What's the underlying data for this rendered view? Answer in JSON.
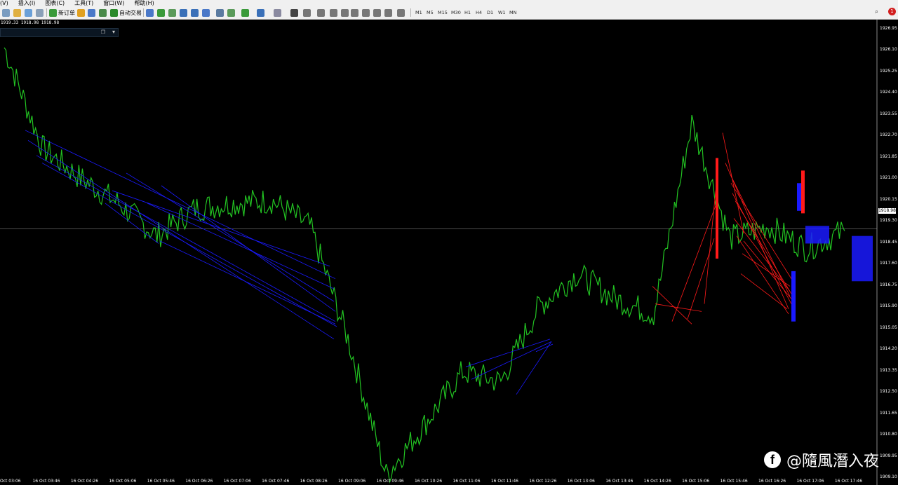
{
  "menu": [
    "(V)",
    "插入(I)",
    "图表(C)",
    "工具(T)",
    "窗口(W)",
    "帮助(H)"
  ],
  "toolbar": {
    "new_order_label": "新订单",
    "auto_trading_label": "自动交易",
    "timeframes": [
      "M1",
      "M5",
      "M15",
      "M30",
      "H1",
      "H4",
      "D1",
      "W1",
      "MN"
    ],
    "notification_count": "1"
  },
  "chart_info": {
    "ohlc_line": "1919.33 1918.98 1918.98",
    "current_price": "1918.98"
  },
  "y_axis_labels": [
    "1926.95",
    "1926.10",
    "1925.25",
    "1924.40",
    "1923.55",
    "1922.70",
    "1921.85",
    "1921.00",
    "1920.15",
    "1919.30",
    "1918.45",
    "1917.60",
    "1916.75",
    "1915.90",
    "1915.05",
    "1914.20",
    "1913.35",
    "1912.50",
    "1911.65",
    "1910.80",
    "1909.95",
    "1909.10"
  ],
  "x_axis_labels": [
    "Oct 03:06",
    "16 Oct 03:46",
    "16 Oct 04:26",
    "16 Oct 05:06",
    "16 Oct 05:46",
    "16 Oct 06:26",
    "16 Oct 07:06",
    "16 Oct 07:46",
    "16 Oct 08:26",
    "16 Oct 09:06",
    "16 Oct 09:46",
    "16 Oct 10:26",
    "16 Oct 11:06",
    "16 Oct 11:46",
    "16 Oct 12:26",
    "16 Oct 13:06",
    "16 Oct 13:46",
    "16 Oct 14:26",
    "16 Oct 15:06",
    "16 Oct 15:46",
    "16 Oct 16:26",
    "16 Oct 17:06",
    "16 Oct 17:46"
  ],
  "watermark": {
    "icon": "facebook-icon",
    "text": "@隨風潛入夜"
  },
  "colors": {
    "price_line": "#22c322",
    "buy_lines": "#1a1aff",
    "sell_lines": "#ff1a1a",
    "background": "#000000"
  },
  "chart_data": {
    "type": "line",
    "ylim": [
      1908.8,
      1927.3
    ],
    "x": [
      "03:06",
      "03:46",
      "04:26",
      "05:06",
      "05:46",
      "06:26",
      "07:06",
      "07:46",
      "08:26",
      "09:06",
      "09:46",
      "10:26",
      "11:06",
      "11:46",
      "12:26",
      "13:06",
      "13:46",
      "14:26",
      "15:06",
      "15:46",
      "16:26",
      "17:06",
      "17:46"
    ],
    "series": [
      {
        "values": [
          1926.2,
          1922.2,
          1921.0,
          1920.0,
          1918.7,
          1919.8,
          1920.0,
          1920.1,
          1919.1,
          1914.6,
          1909.2,
          1911.2,
          1913.3,
          1912.9,
          1915.9,
          1917.2,
          1916.2,
          1915.6,
          1923.2,
          1918.6,
          1919.1,
          1918.2,
          1918.9
        ]
      }
    ]
  }
}
